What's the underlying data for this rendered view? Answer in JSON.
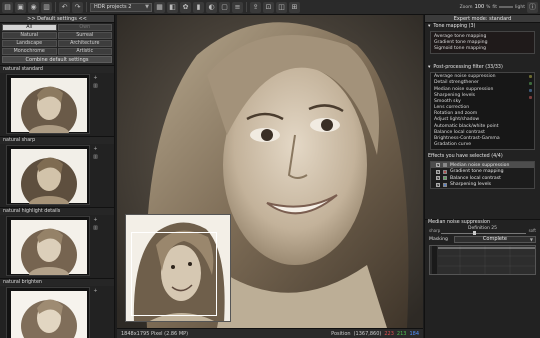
{
  "toolbar": {
    "project_select": "HDR projects 2",
    "zoom_label": "Zoom",
    "zoom_value": "100",
    "fit_label": "fit",
    "light_label": "light"
  },
  "left": {
    "title": ">> Default settings <<",
    "presets": [
      {
        "label": "All",
        "state": "active"
      },
      {
        "label": "Own",
        "state": "dim"
      },
      {
        "label": "Natural",
        "state": ""
      },
      {
        "label": "Surreal",
        "state": ""
      },
      {
        "label": "Landscape",
        "state": ""
      },
      {
        "label": "Architecture",
        "state": ""
      },
      {
        "label": "Monochrome",
        "state": ""
      },
      {
        "label": "Artistic",
        "state": ""
      }
    ],
    "combine_label": "Combine default settings",
    "thumbnails": [
      {
        "label": "natural standard"
      },
      {
        "label": "natural sharp"
      },
      {
        "label": "natural highlight details"
      },
      {
        "label": "natural brighten"
      }
    ]
  },
  "status": {
    "size": "1848x1795 Pixel (2.86 MP)",
    "position_label": "Position",
    "position_value": "(1367,860)",
    "rgb_r": "223",
    "rgb_g": "213",
    "rgb_b": "184"
  },
  "right": {
    "title": "Expert mode: standard",
    "tone_header": "Tone mapping (3)",
    "tone_items": [
      "Average tone mapping",
      "Gradient tone mapping",
      "Sigmoid tone mapping"
    ],
    "post_header": "Post-processing filter (33/33)",
    "post_items": [
      "Average noise suppression",
      "Detail strengthener",
      "Median noise suppression",
      "Sharpening levels",
      "Smooth sky",
      "Lens correction",
      "Rotation and zoom",
      "Adjust light/shadow",
      "Automatic black/white point",
      "Balance local contrast",
      "Brightness-Contrast-Gamma",
      "Gradation curve"
    ],
    "effects_header": "Effects you have selected (4/4)",
    "effects": [
      {
        "label": "Median noise suppression",
        "checked": true,
        "color": "#8a8a8a",
        "selected": true
      },
      {
        "label": "Gradient tone mapping",
        "checked": true,
        "color": "#b05050",
        "selected": false
      },
      {
        "label": "Balance local contrast",
        "checked": true,
        "color": "#5aa05a",
        "selected": false
      },
      {
        "label": "Sharpening levels",
        "checked": true,
        "color": "#5a80c0",
        "selected": false
      }
    ],
    "param_header": "Median noise suppression",
    "slider_left": "sharp",
    "slider_right": "soft",
    "definition_label": "Definition",
    "definition_value": "25",
    "masking_label": "Masking",
    "masking_value": "Complete"
  },
  "colors": {
    "scroll_dots": [
      "#6a6a30",
      "#3d6a3d",
      "#3d5a7a",
      "#7a3d3d"
    ]
  }
}
